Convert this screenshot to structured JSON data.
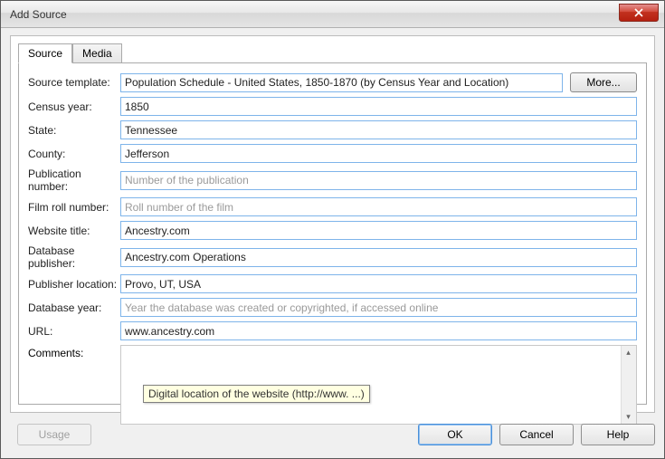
{
  "window": {
    "title": "Add Source"
  },
  "tabs": {
    "source": "Source",
    "media": "Media"
  },
  "buttons": {
    "more": "More...",
    "usage": "Usage",
    "ok": "OK",
    "cancel": "Cancel",
    "help": "Help"
  },
  "fields": {
    "source_template": {
      "label": "Source template:",
      "value": "Population Schedule - United States, 1850-1870 (by Census Year and Location)"
    },
    "census_year": {
      "label": "Census year:",
      "value": "1850"
    },
    "state": {
      "label": "State:",
      "value": "Tennessee"
    },
    "county": {
      "label": "County:",
      "value": "Jefferson"
    },
    "pub_number": {
      "label": "Publication number:",
      "value": "",
      "placeholder": "Number of the publication"
    },
    "film_roll": {
      "label": "Film roll number:",
      "value": "",
      "placeholder": "Roll number of the film"
    },
    "website_title": {
      "label": "Website title:",
      "value": "Ancestry.com"
    },
    "db_publisher": {
      "label": "Database publisher:",
      "value": "Ancestry.com Operations"
    },
    "pub_location": {
      "label": "Publisher location:",
      "value": "Provo, UT, USA"
    },
    "db_year": {
      "label": "Database year:",
      "value": "",
      "placeholder": "Year the database was created or copyrighted, if accessed online"
    },
    "url": {
      "label": "URL:",
      "value": "www.ancestry.com"
    },
    "comments": {
      "label": "Comments:",
      "value": ""
    }
  },
  "tooltip": "Digital location of the website (http://www. ...)"
}
